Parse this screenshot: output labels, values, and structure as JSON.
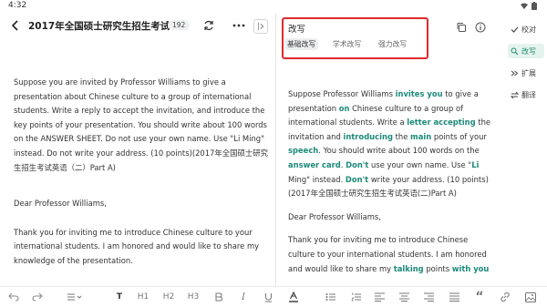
{
  "status_bar": {
    "time": "4:32"
  },
  "header": {
    "title": "2017年全国硕士研究生招生考试",
    "word_count": "192"
  },
  "left_document": {
    "prompt": "Suppose you are invited by Professor Williams to give a presentation about Chinese culture to a group of international students. Write a reply to accept the invitation, and introduce the key points of your presentation. You should write about 100 words on the ANSWER SHEET. Do not use your own name. Use \"Li Ming\" instead. Do not write your address. (10 points)(2017年全国硕士研究生招生考试英语（二）Part A)",
    "greeting": "Dear Professor Williams,",
    "body": "Thank you for inviting me to introduce Chinese culture to your international students. I am honored and would like to share my knowledge of the presentation."
  },
  "rewrite_panel": {
    "title": "改写",
    "modes": [
      "基础改写",
      "学术改写",
      "强力改写"
    ],
    "active_mode": "基础改写",
    "p1": [
      {
        "t": "Suppose Professor Williams "
      },
      {
        "t": "invites you",
        "hl": true
      },
      {
        "t": " to give a presentation "
      },
      {
        "t": "on",
        "hl": true
      },
      {
        "t": " Chinese culture to a group of international students. Write a "
      },
      {
        "t": "letter accepting",
        "hl": true
      },
      {
        "t": " the invitation and "
      },
      {
        "t": "introducing",
        "hl": true
      },
      {
        "t": " the "
      },
      {
        "t": "main",
        "hl": true
      },
      {
        "t": " points of your "
      },
      {
        "t": "speech",
        "hl": true
      },
      {
        "t": ". You should write about 100 words on the "
      },
      {
        "t": "answer card",
        "hl": true
      },
      {
        "t": ". "
      },
      {
        "t": "Don't",
        "hl": true
      },
      {
        "t": " use your own name. Use \""
      },
      {
        "t": "Li",
        "hl": true
      },
      {
        "t": " Ming\" instead. "
      },
      {
        "t": "Don't",
        "hl": true
      },
      {
        "t": " write your address. (10 points) (2017年全国硕士研究生招生考试英语(二)Part A)"
      }
    ],
    "greeting": "Dear Professor Williams,",
    "p2": [
      {
        "t": "Thank you for inviting me to introduce Chinese culture to your international students. I am honored and would like to share my "
      },
      {
        "t": "talking",
        "hl": true
      },
      {
        "t": " points "
      },
      {
        "t": "with you",
        "hl": true
      }
    ]
  },
  "sidebar": {
    "items": [
      {
        "label": "校对",
        "icon": "check-icon"
      },
      {
        "label": "改写",
        "icon": "rewrite-icon",
        "active": true
      },
      {
        "label": "扩展",
        "icon": "expand-icon"
      },
      {
        "label": "翻译",
        "icon": "translate-icon"
      }
    ]
  },
  "toolbar": {
    "bold": "T",
    "h1": "H1",
    "h2": "H2",
    "h3": "H3",
    "italic": "I",
    "quote": "“"
  },
  "colors": {
    "accent": "#1d8a7a",
    "highlight_border": "#e02a2a"
  }
}
